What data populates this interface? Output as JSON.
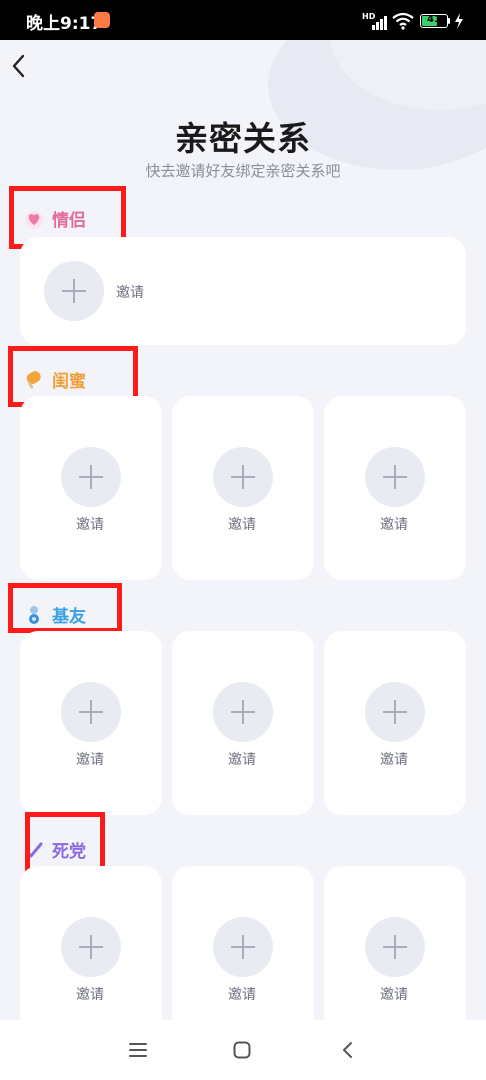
{
  "status_bar": {
    "time": "晚上9:17",
    "hd": "HD",
    "battery": "41"
  },
  "header": {
    "title": "亲密关系",
    "subtitle": "快去邀请好友绑定亲密关系吧"
  },
  "sections": [
    {
      "label": "情侣",
      "color": "#e46ba0",
      "icon": "heart-icon",
      "slots": [
        {
          "invite_label": "邀请"
        }
      ]
    },
    {
      "label": "闺蜜",
      "color": "#f0a03a",
      "icon": "popsicle-icon",
      "slots": [
        {
          "invite_label": "邀请"
        },
        {
          "invite_label": "邀请"
        },
        {
          "invite_label": "邀请"
        }
      ]
    },
    {
      "label": "基友",
      "color": "#3aa0e6",
      "icon": "figure-icon",
      "slots": [
        {
          "invite_label": "邀请"
        },
        {
          "invite_label": "邀请"
        },
        {
          "invite_label": "邀请"
        }
      ]
    },
    {
      "label": "死党",
      "color": "#8a6ae0",
      "icon": "check-icon",
      "slots": [
        {
          "invite_label": "邀请"
        },
        {
          "invite_label": "邀请"
        },
        {
          "invite_label": "邀请"
        }
      ]
    }
  ],
  "nav": {
    "icons": [
      "menu-icon",
      "home-icon",
      "back-icon"
    ]
  }
}
